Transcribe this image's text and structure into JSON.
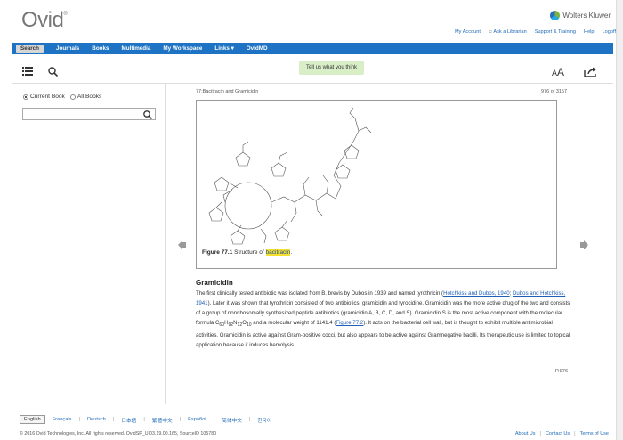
{
  "header": {
    "logo": "Ovid",
    "logo_mark": "®",
    "brand": "Wolters Kluwer",
    "top_links": [
      "My Account",
      "Ask a Librarian",
      "Support & Training",
      "Help",
      "Logoff"
    ]
  },
  "nav": {
    "items": [
      "Search",
      "Journals",
      "Books",
      "Multimedia",
      "My Workspace",
      "Links ▾",
      "OvidMD"
    ]
  },
  "toolbar": {
    "feedback": "Tell us what you think",
    "font_size_label": "A",
    "font_size_label_big": "A"
  },
  "search_panel": {
    "scope_options": [
      "Current Book",
      "All Books"
    ],
    "selected_scope": "Current Book",
    "query": ""
  },
  "content": {
    "breadcrumb": "77:Bacitracin and Gramicidin",
    "page_count": "976 of 3157",
    "figure": {
      "label": "Figure 77.1",
      "caption": " Structure of ",
      "highlight": "bacitracin",
      "caption_end": "."
    },
    "section_title": "Gramicidin",
    "paragraph": {
      "t1": "The first clinically tested antibiotic was isolated from B. brevis by Dubos in 1939 and named tyrothricin (",
      "link1": "Hotchkiss and Dubos, 1940",
      "t2": "; ",
      "link2": "Dubos and Hotchkiss, 1941",
      "t3": "). Later it was shown that tyrothricin consisted of two antibiotics, gramicidin and tyrocidine. Gramicidin was the more active drug of the two and consists of a group of nonribosomally synthesized peptide antibiotics (gramicidin A, B, C, D, and S). Gramicidin S is the most active component with the molecular formula C",
      "sub1": "60",
      "t4": "H",
      "sub2": "92",
      "t5": "N",
      "sub3": "12",
      "t6": "O",
      "sub4": "10",
      "t7": " and a molecular weight of 1141.4 (",
      "link3": "Figure 77.2",
      "t8": "). It acts on the bacterial cell wall, but is thought to exhibit multiple antimicrobial activities. Gramicidin is active against Gram-positive cocci, but also appears to be active against Gramnegative bacilli. Its therapeutic use is limited to topical application because it induces hemolysis."
    },
    "page_number": "P.976"
  },
  "footer": {
    "languages": [
      "English",
      "Français",
      "Deutsch",
      "日本語",
      "繁體中文",
      "Español",
      "简体中文",
      "한국어"
    ],
    "copyright": "© 2016 Ovid Technologies, Inc. All rights reserved.   OvidSP_UI03.19.00.165, SourceID 105780",
    "links": [
      "About Us",
      "Contact Us",
      "Terms of Use"
    ]
  },
  "colors": {
    "nav_bg": "#1e73c4",
    "link": "#1f6bb8",
    "feedback_bg": "#d7eec7",
    "highlight": "#f5e12c"
  }
}
